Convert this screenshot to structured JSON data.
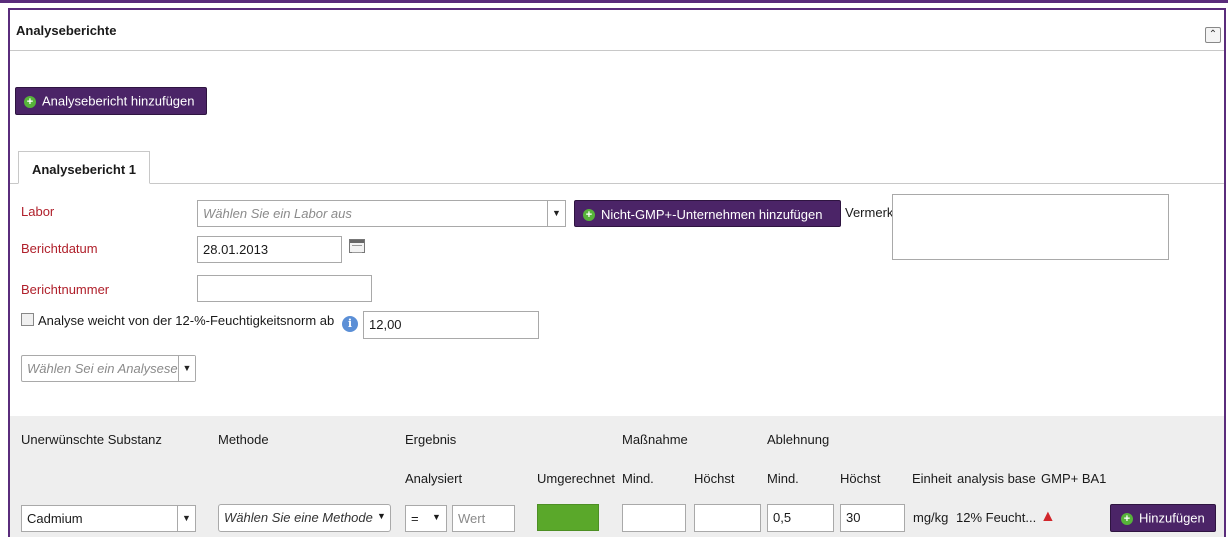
{
  "panel": {
    "title": "Analyseberichte",
    "collapse_icon": "chevron-up-icon"
  },
  "add_report_button": "Analysebericht hinzufügen",
  "tab": {
    "label": "Analysebericht 1"
  },
  "form": {
    "labor_label": "Labor",
    "labor_placeholder": "Wählen Sie ein Labor aus",
    "add_company_button": "Nicht-GMP+-Unternehmen hinzufügen",
    "vermerk_label": "Vermerk",
    "vermerk_value": "",
    "berichtdatum_label": "Berichtdatum",
    "berichtdatum_value": "28.01.2013",
    "berichtnummer_label": "Berichtnummer",
    "berichtnummer_value": "",
    "moisture_checkbox_label": "Analyse weicht von der 12-%-Feuchtigkeitsnorm ab",
    "moisture_checked": false,
    "moisture_value": "12,00",
    "analysis_set_placeholder": "Wählen Sei ein Analysese"
  },
  "table": {
    "headers_top": {
      "substanz": "Unerwünschte Substanz",
      "methode": "Methode",
      "ergebnis": "Ergebnis",
      "massnahme": "Maßnahme",
      "ablehnung": "Ablehnung"
    },
    "headers_sub": {
      "analysiert": "Analysiert",
      "umgerechnet": "Umgerechnet",
      "mind1": "Mind.",
      "hoechst1": "Höchst",
      "mind2": "Mind.",
      "hoechst2": "Höchst",
      "einheit": "Einheit",
      "analysis_base": "analysis base",
      "gmp_ba1": "GMP+ BA1"
    },
    "row": {
      "substanz": "Cadmium",
      "methode_placeholder": "Wählen Sie eine Methode",
      "operator": "=",
      "wert_placeholder": "Wert",
      "umgerechnet_color": "#5aa82a",
      "massnahme_mind": "",
      "massnahme_hoechst": "",
      "ablehnung_mind": "0,5",
      "ablehnung_hoechst": "30",
      "einheit": "mg/kg",
      "analysis_base": "12% Feucht...",
      "gmp_icon": "pdf-icon",
      "add_button": "Hinzufügen"
    }
  },
  "colors": {
    "brand": "#4b2467",
    "required_label": "#b0202b",
    "add_icon": "#57b33a"
  }
}
